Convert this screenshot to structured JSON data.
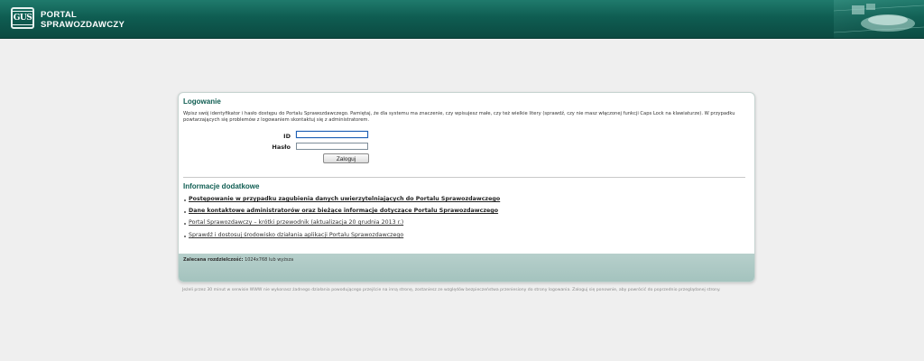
{
  "header": {
    "logo_text": "GUS",
    "title_line1": "PORTAL",
    "title_line2": "SPRAWOZDAWCZY",
    "colors": {
      "primary": "#0f5d52",
      "accent": "#1f7a6c"
    }
  },
  "login": {
    "title": "Logowanie",
    "instructions": "Wpisz swój identyfikator i hasło dostępu do Portalu Sprawozdawczego. Pamiętaj, że dla systemu ma znaczenie, czy wpisujesz małe, czy też wielkie litery (sprawdź, czy nie masz włączonej funkcji Caps Lock na klawiaturze). W przypadku powtarzających się problemów z logowaniem skontaktuj się z administratorem.",
    "id_label": "ID",
    "id_value": "",
    "password_label": "Hasło",
    "password_value": "",
    "submit_label": "Zaloguj"
  },
  "info": {
    "title": "Informacje dodatkowe",
    "links": [
      {
        "label": "Postępowanie w przypadku zagubienia danych uwierzytelniających do Portalu Sprawozdawczego",
        "bold": true
      },
      {
        "label": "Dane kontaktowe administratorów oraz bieżące informacje dotyczące Portalu Sprawozdawczego",
        "bold": true
      },
      {
        "label": "Portal Sprawozdawczy – krótki przewodnik (aktualizacja 20 grudnia 2013 r.)",
        "bold": false
      },
      {
        "label": "Sprawdź i dostosuj środowisko działania aplikacji Portalu Sprawozdawczego",
        "bold": false
      }
    ]
  },
  "footer": {
    "resolution_label": "Zalecana rozdzielczość:",
    "resolution_value": " 1024x768 lub wyższa"
  },
  "session_note": "Jeżeli przez 30 minut w serwisie WWW nie wykonasz żadnego działania powodującego przejście na inną stronę, zostaniesz ze względów bezpieczeństwa przeniesiony do strony logowania. Zaloguj się ponownie, aby powrócić do poprzednio przeglądanej strony."
}
